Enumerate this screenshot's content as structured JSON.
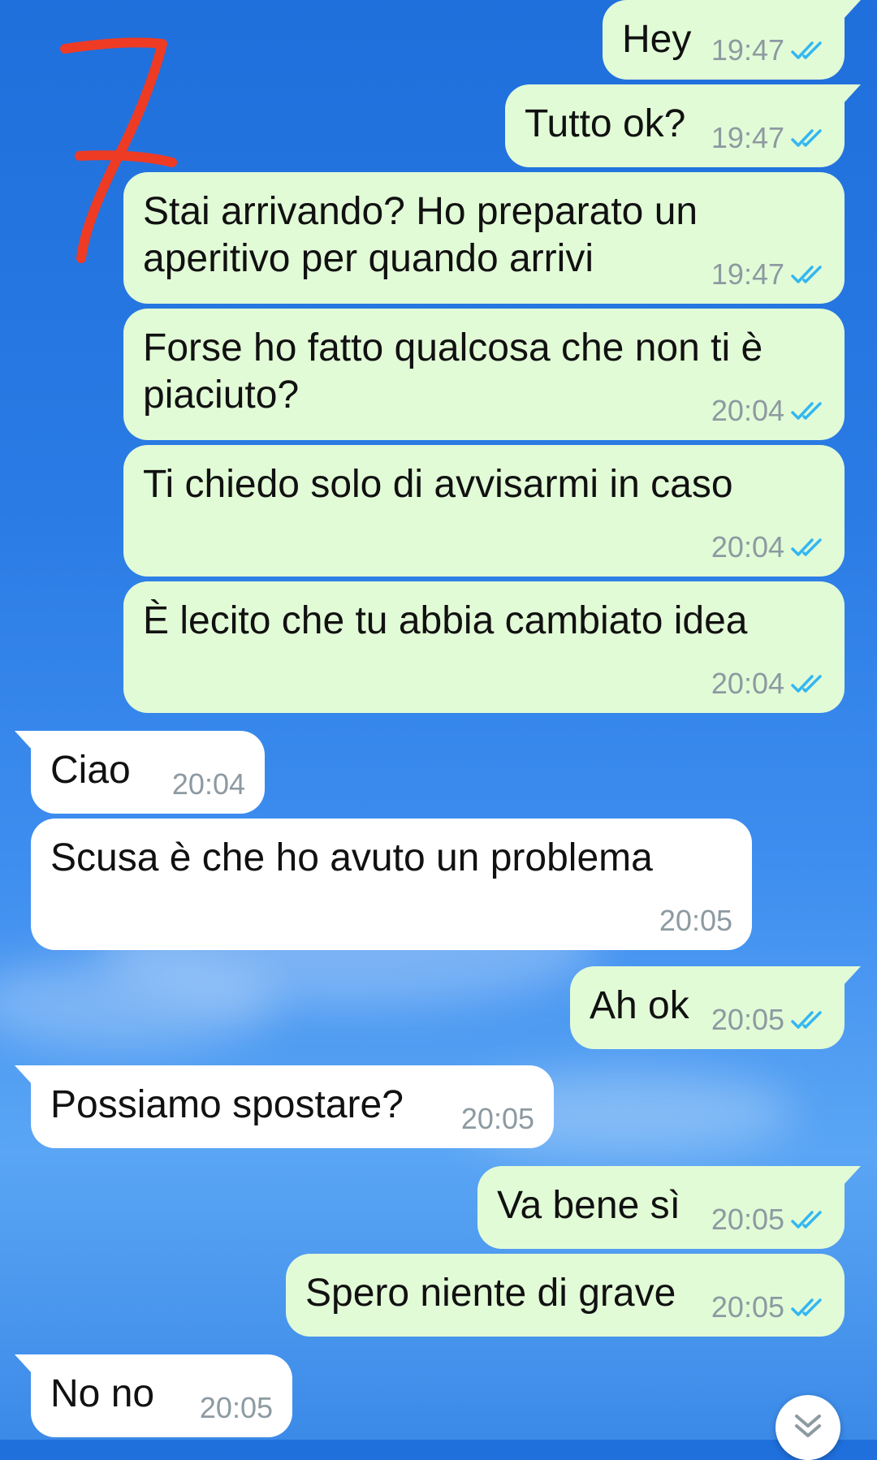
{
  "messages": [
    {
      "dir": "out",
      "text": "Hey",
      "time": "19:47",
      "read": true
    },
    {
      "dir": "out",
      "text": "Tutto ok?",
      "time": "19:47",
      "read": true
    },
    {
      "dir": "out",
      "text": "Stai arrivando? Ho preparato un\naperitivo per quando arrivi",
      "time": "19:47",
      "read": true
    },
    {
      "dir": "out",
      "text": "Forse ho fatto qualcosa che non ti è\npiaciuto?",
      "time": "20:04",
      "read": true
    },
    {
      "dir": "out",
      "text": "Ti chiedo solo di avvisarmi in caso",
      "time": "20:04",
      "read": true
    },
    {
      "dir": "out",
      "text": "È lecito che tu abbia cambiato idea",
      "time": "20:04",
      "read": true
    },
    {
      "dir": "in",
      "text": "Ciao",
      "time": "20:04"
    },
    {
      "dir": "in",
      "text": "Scusa è che ho avuto un problema",
      "time": "20:05"
    },
    {
      "dir": "out",
      "text": "Ah ok",
      "time": "20:05",
      "read": true
    },
    {
      "dir": "in",
      "text": "Possiamo spostare?",
      "time": "20:05"
    },
    {
      "dir": "out",
      "text": "Va bene sì",
      "time": "20:05",
      "read": true
    },
    {
      "dir": "out",
      "text": "Spero niente di grave",
      "time": "20:05",
      "read": true
    },
    {
      "dir": "in",
      "text": "No no",
      "time": "20:05"
    }
  ],
  "annotation": {
    "label": "7",
    "color": "#ee3b24"
  },
  "colors": {
    "outgoing_bubble": "#e2fbd7",
    "incoming_bubble": "#ffffff",
    "read_ticks": "#34b7f1",
    "timestamp": "#8d9aa1"
  },
  "icons": {
    "read_receipt": "double-check-icon",
    "scroll_down": "chevron-double-down-icon"
  }
}
